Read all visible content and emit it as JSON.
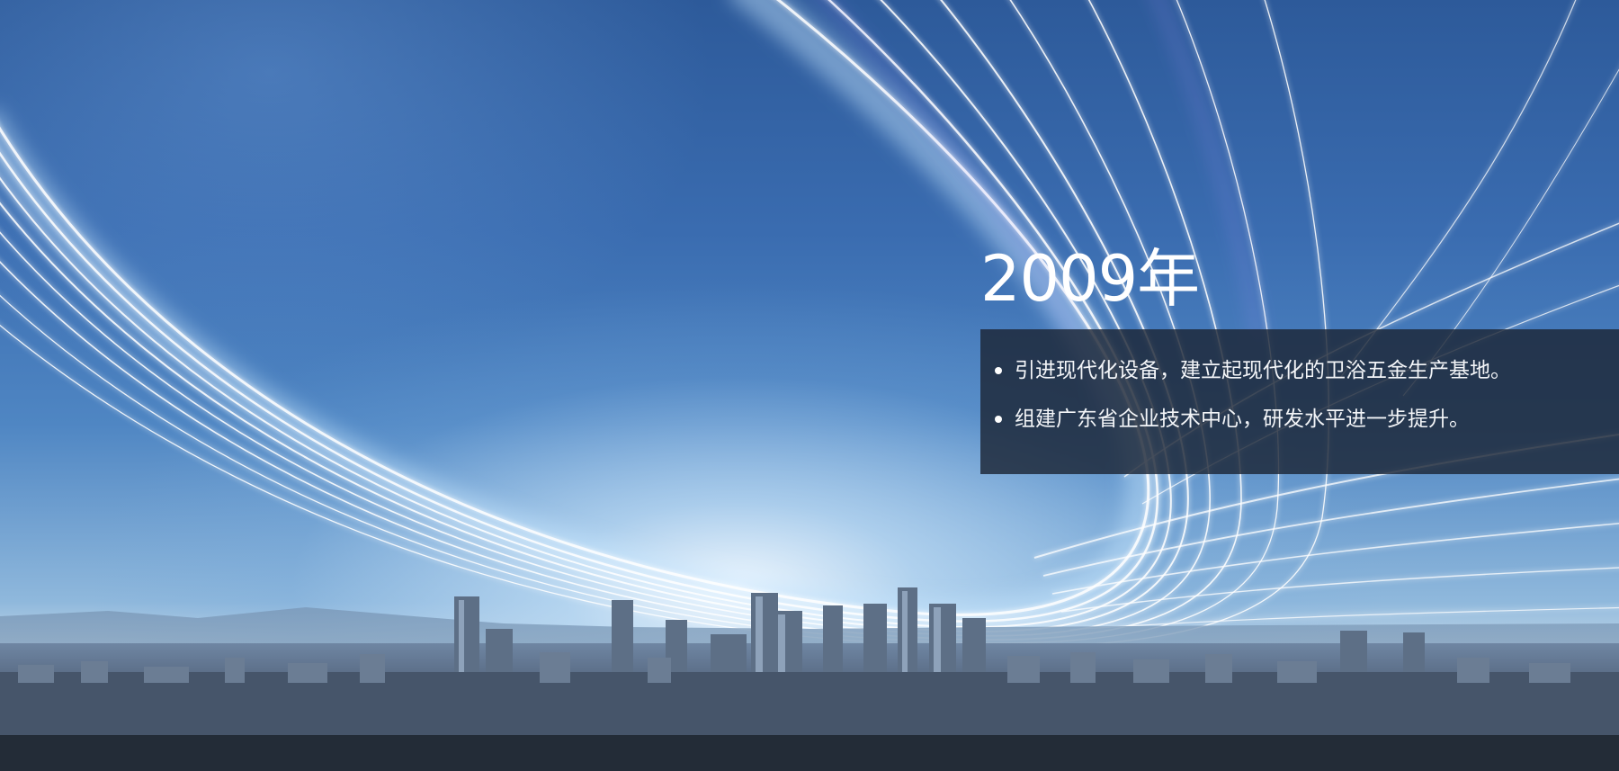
{
  "slide": {
    "year": "2009年",
    "items": [
      {
        "text": "引进现代化设备，建立起现代化的卫浴五金生产基地。"
      },
      {
        "text": "组建广东省企业技术中心，研发水平进一步提升。"
      }
    ]
  },
  "colors": {
    "sky_top": "#2d5a9a",
    "sky_glow": "#eaf4ff",
    "panel_background": "rgba(28,38,54,0.82)",
    "text": "#ffffff"
  }
}
